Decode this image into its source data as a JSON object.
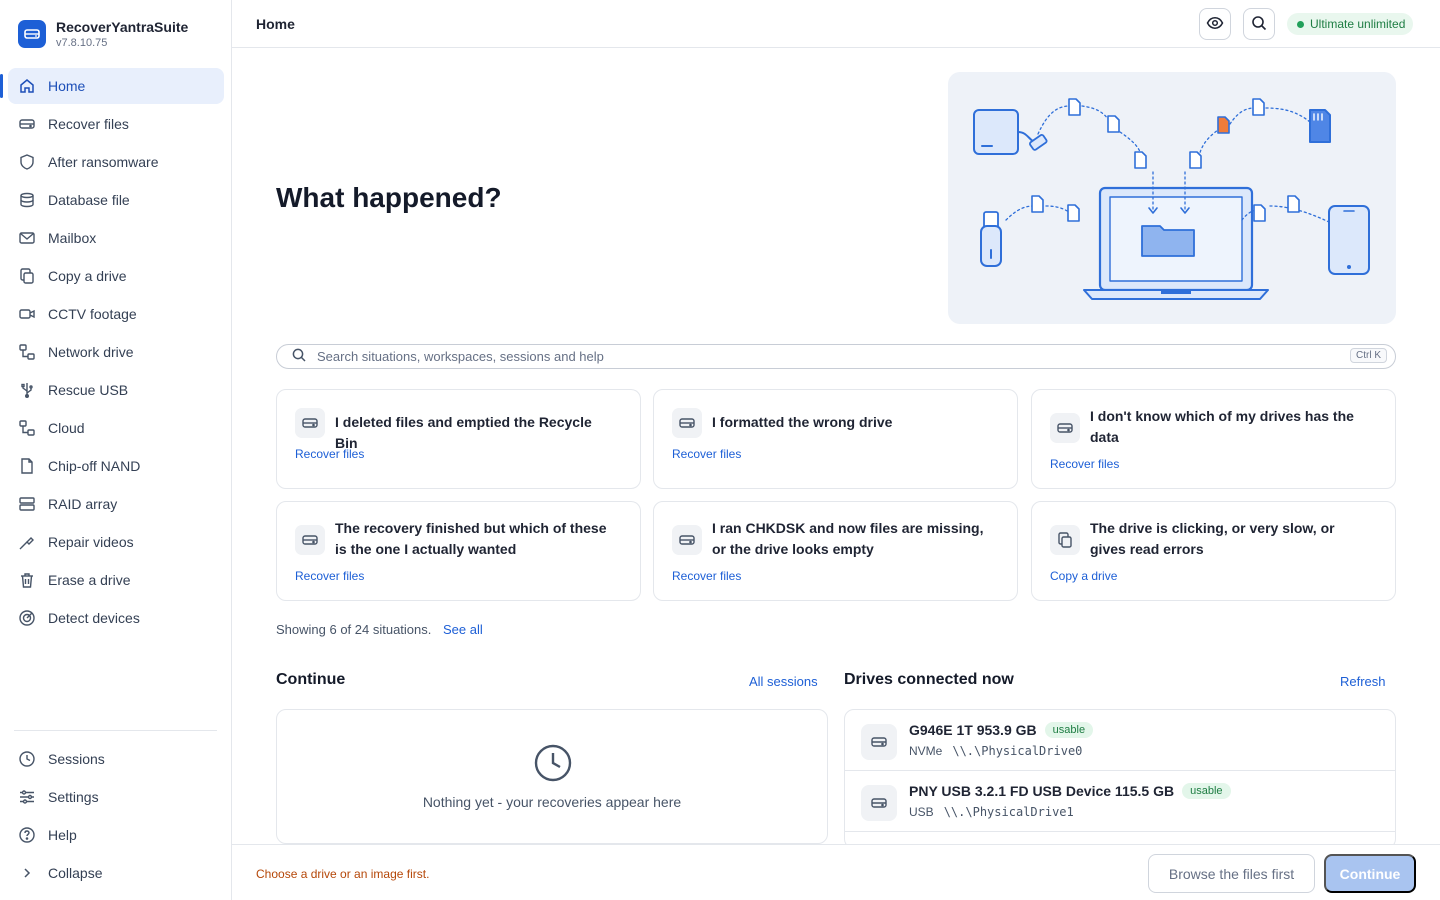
{
  "app": {
    "name": "RecoverYantraSuite",
    "version": "v7.8.10.75"
  },
  "sidebar": {
    "items": [
      {
        "label": "Home",
        "icon": "home-icon"
      },
      {
        "label": "Recover files",
        "icon": "drive-icon"
      },
      {
        "label": "After ransomware",
        "icon": "shield-icon"
      },
      {
        "label": "Database file",
        "icon": "database-icon"
      },
      {
        "label": "Mailbox",
        "icon": "mail-icon"
      },
      {
        "label": "Copy a drive",
        "icon": "copy-icon"
      },
      {
        "label": "CCTV footage",
        "icon": "video-camera-icon"
      },
      {
        "label": "Network drive",
        "icon": "network-icon"
      },
      {
        "label": "Rescue USB",
        "icon": "usb-icon"
      },
      {
        "label": "Cloud",
        "icon": "cloud-icon"
      },
      {
        "label": "Chip-off NAND",
        "icon": "chip-icon"
      },
      {
        "label": "RAID array",
        "icon": "raid-icon"
      },
      {
        "label": "Repair videos",
        "icon": "wrench-icon"
      },
      {
        "label": "Erase a drive",
        "icon": "trash-icon"
      },
      {
        "label": "Detect devices",
        "icon": "radar-icon"
      }
    ],
    "bottom": [
      {
        "label": "Sessions",
        "icon": "clock-icon"
      },
      {
        "label": "Settings",
        "icon": "sliders-icon"
      },
      {
        "label": "Help",
        "icon": "help-icon"
      },
      {
        "label": "Collapse",
        "icon": "chevron-right-icon"
      }
    ]
  },
  "topbar": {
    "title": "Home",
    "license": "Ultimate unlimited"
  },
  "hero": {
    "title": "What happened?"
  },
  "search": {
    "placeholder": "Search situations, workspaces, sessions and help",
    "shortcut": "Ctrl K"
  },
  "situations": [
    {
      "title": "I deleted files and emptied the Recycle Bin",
      "link": "Recover files"
    },
    {
      "title": "I formatted the wrong drive",
      "link": "Recover files"
    },
    {
      "title": "I don't know which of my drives has the data",
      "link": "Recover files"
    },
    {
      "title": "The recovery finished but which of these is the one I actually wanted",
      "link": "Recover files"
    },
    {
      "title": "I ran CHKDSK and now files are missing, or the drive looks empty",
      "link": "Recover files"
    },
    {
      "title": "The drive is clicking, or very slow, or gives read errors",
      "link": "Copy a drive"
    }
  ],
  "showing": {
    "text": "Showing 6 of 24 situations.",
    "see_all": "See all"
  },
  "continue": {
    "title": "Continue",
    "link": "All sessions",
    "empty": "Nothing yet - your recoveries appear here"
  },
  "drives": {
    "title": "Drives connected now",
    "link": "Refresh",
    "items": [
      {
        "name": "G946E 1T 953.9 GB",
        "badge": "usable",
        "bus": "NVMe",
        "path": "\\\\.\\PhysicalDrive0"
      },
      {
        "name": "PNY USB 3.2.1 FD USB Device 115.5 GB",
        "badge": "usable",
        "bus": "USB",
        "path": "\\\\.\\PhysicalDrive1"
      }
    ]
  },
  "footer": {
    "message": "Choose a drive or an image first.",
    "secondary": "Browse the files first",
    "primary": "Continue"
  },
  "colors": {
    "accent": "#1d5fd6",
    "success": "#22a05a",
    "warning": "#b54708",
    "orange_file": "#f07c3a"
  }
}
